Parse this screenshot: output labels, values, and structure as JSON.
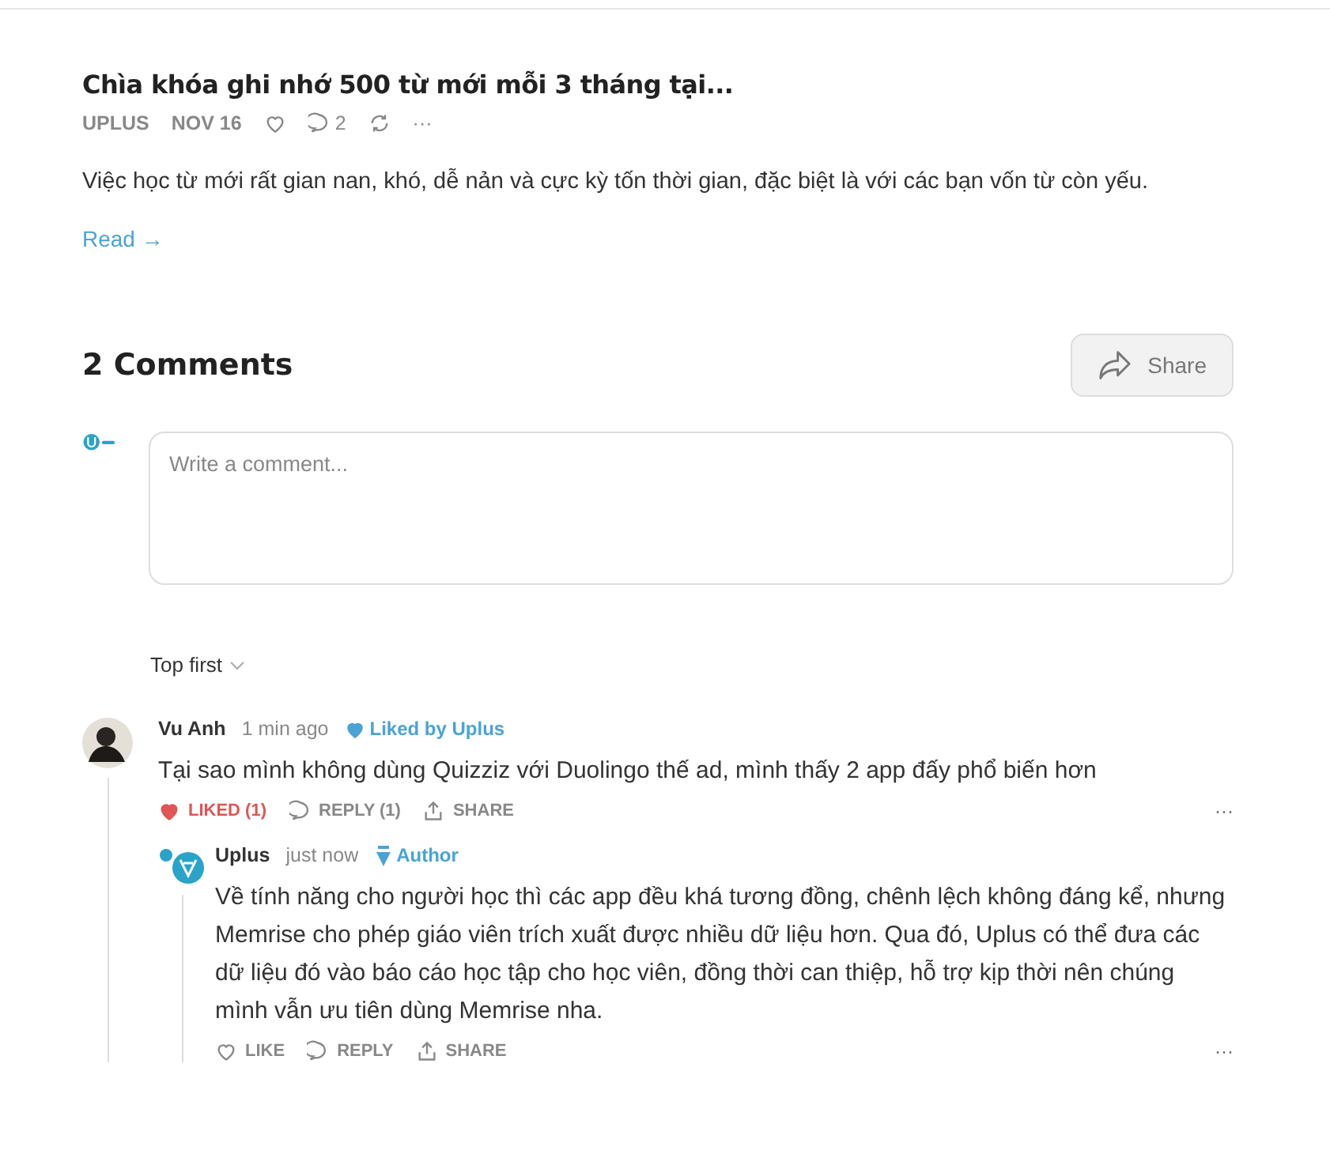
{
  "article": {
    "title": "Chìa khóa ghi nhớ 500 từ mới mỗi 3 tháng tại...",
    "author": "UPLUS",
    "date": "NOV 16",
    "comment_count": "2",
    "more": "···",
    "excerpt": "Việc học từ mới rất gian nan, khó, dễ nản và cực kỳ tốn thời gian, đặc biệt là với các bạn vốn từ còn yếu.",
    "read_link": "Read →"
  },
  "comments_heading": "2 Comments",
  "share_button": "Share",
  "comment_box": {
    "placeholder": "Write a comment..."
  },
  "sort": "Top first",
  "comments": [
    {
      "author": "Vu Anh",
      "time": "1 min ago",
      "badge": {
        "kind": "liked",
        "label": "Liked by Uplus"
      },
      "text": "Tại sao mình không dùng Quizziz với Duolingo thế ad, mình thấy 2 app đấy phổ biến hơn",
      "like": {
        "label": "LIKED (1)",
        "liked": true
      },
      "reply": "REPLY (1)",
      "share": "SHARE",
      "more": "···",
      "replies": [
        {
          "author": "Uplus",
          "time": "just now",
          "badge": {
            "kind": "author",
            "label": "Author"
          },
          "text": "Về tính năng cho người học thì các app đều khá tương đồng, chênh lệch không đáng kể, nhưng Memrise cho phép giáo viên trích xuất được nhiều dữ liệu hơn. Qua đó, Uplus có thể đưa các dữ liệu đó vào báo cáo học tập cho học viên, đồng thời can thiệp, hỗ trợ kịp thời nên chúng mình vẫn ưu tiên dùng Memrise nha.",
          "like": {
            "label": "LIKE",
            "liked": false
          },
          "reply": "REPLY",
          "share": "SHARE",
          "more": "···"
        }
      ]
    }
  ]
}
